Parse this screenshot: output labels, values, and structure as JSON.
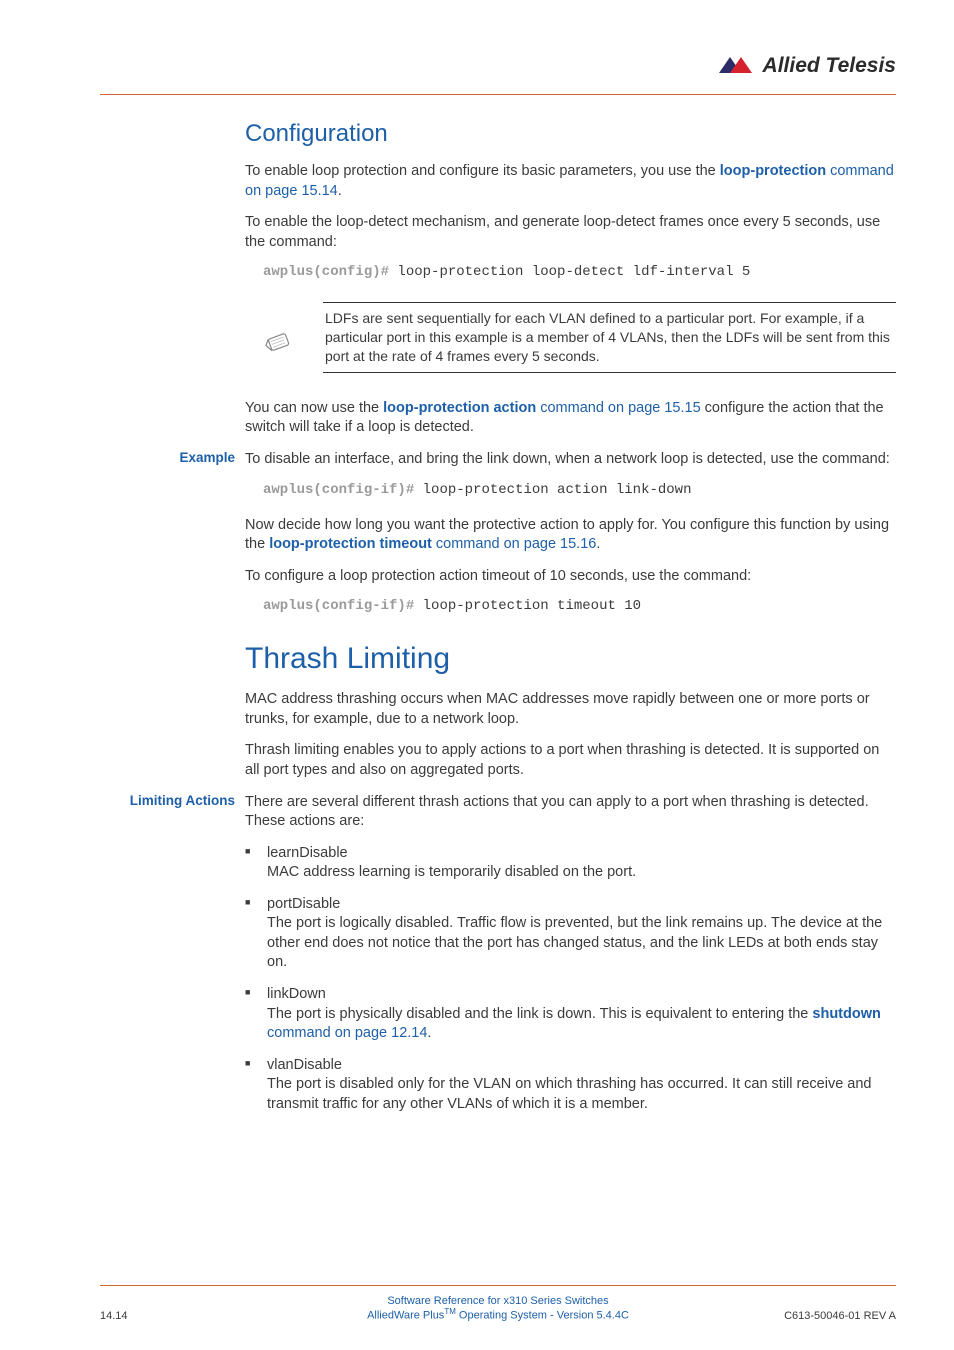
{
  "header": {
    "brand": "Allied Telesis"
  },
  "sect1": {
    "title": "Configuration",
    "p1_a": "To enable loop protection and configure its basic parameters, you use the ",
    "p1_link": "loop-protection",
    "p1_link_suffix": " command on page 15.14",
    "p1_b": ".",
    "p2": "To enable the loop-detect mechanism, and generate loop-detect frames once every 5 seconds, use the command:",
    "code1_prompt": "awplus(config)#",
    "code1_cmd": " loop-protection loop-detect ldf-interval 5",
    "note": "LDFs are sent sequentially for each VLAN defined to a particular port. For example, if a particular port in this example is a member of 4 VLANs, then the LDFs will be sent from this port at the rate of 4 frames every 5 seconds.",
    "p3_a": "You can now use the ",
    "p3_link": "loop-protection action",
    "p3_link_suffix": " command on page 15.15",
    "p3_b": " configure the action that the switch will take if a loop is detected.",
    "example_label": "Example",
    "p4": "To disable an interface, and bring the link down, when a network loop is detected, use the command:",
    "code2_prompt": "awplus(config-if)#",
    "code2_cmd": " loop-protection action link-down",
    "p5_a": "Now decide how long you want the protective action to apply for. You configure this function by using the ",
    "p5_link": "loop-protection timeout",
    "p5_link_suffix": " command on page 15.16",
    "p5_b": ".",
    "p6": "To configure a loop protection action timeout of 10 seconds, use the command:",
    "code3_prompt": "awplus(config-if)#",
    "code3_cmd": " loop-protection timeout 10"
  },
  "sect2": {
    "title": "Thrash Limiting",
    "p1": "MAC address thrashing occurs when MAC addresses move rapidly between one or more ports or trunks, for example, due to a network loop.",
    "p2": "Thrash limiting enables you to apply actions to a port when thrashing is detected. It is supported on all port types and also on aggregated ports.",
    "limiting_label": "Limiting Actions",
    "p3": "There are several different thrash actions that you can apply to a port when thrashing is detected. These actions are:",
    "items": [
      {
        "name": "learnDisable",
        "desc": "MAC address learning is temporarily disabled on the port."
      },
      {
        "name": "portDisable",
        "desc": "The port is logically disabled. Traffic flow is prevented, but the link remains up. The device at the other end does not notice that the port has changed status, and the link LEDs at both ends stay on."
      },
      {
        "name": "linkDown",
        "desc_a": "The port is physically disabled and the link is down. This is equivalent to entering the ",
        "link": "shutdown",
        "link_suffix": " command on page 12.14",
        "desc_b": "."
      },
      {
        "name": "vlanDisable",
        "desc": "The port is disabled only for the VLAN on which thrashing has occurred. It can still receive and transmit traffic for any other VLANs of which it is a member."
      }
    ]
  },
  "footer": {
    "page": "14.14",
    "line1": "Software Reference for x310 Series Switches",
    "line2_a": "AlliedWare Plus",
    "line2_tm": "TM",
    "line2_b": " Operating System  - Version 5.4.4C",
    "rev": "C613-50046-01 REV A"
  }
}
